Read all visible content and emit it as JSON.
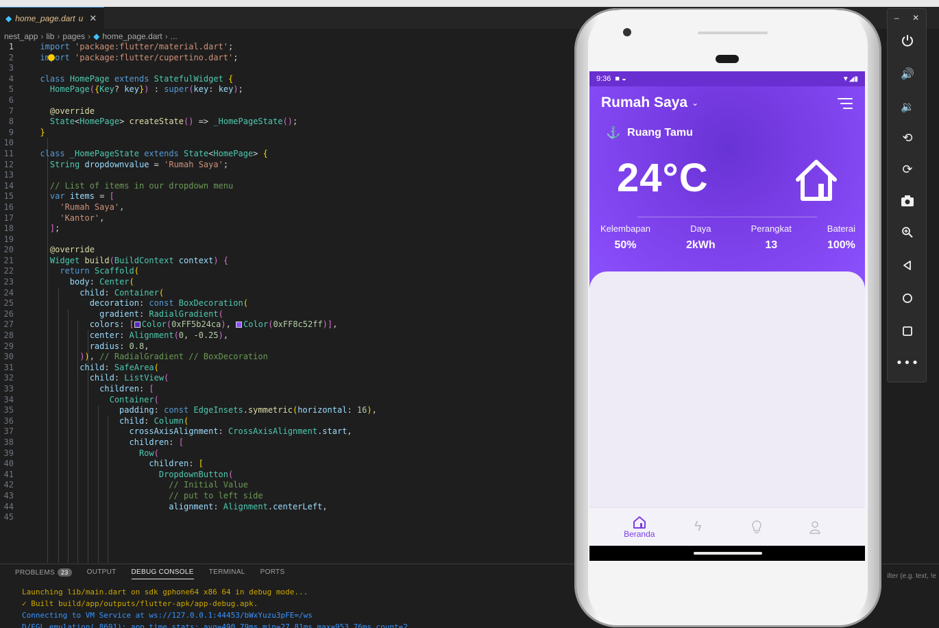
{
  "editor": {
    "tab": {
      "filename": "home_page.dart",
      "modified_flag": "U"
    },
    "breadcrumb": [
      "nest_app",
      "lib",
      "pages",
      "home_page.dart",
      "..."
    ],
    "lines": [
      "1",
      "2",
      "3",
      "4",
      "5",
      "6",
      "7",
      "8",
      "9",
      "10",
      "11",
      "12",
      "13",
      "14",
      "15",
      "16",
      "17",
      "18",
      "19",
      "20",
      "21",
      "22",
      "23",
      "24",
      "25",
      "26",
      "27",
      "28",
      "29",
      "30",
      "31",
      "32",
      "33",
      "34",
      "35",
      "36",
      "37",
      "38",
      "39",
      "40",
      "41",
      "42",
      "43",
      "44",
      "45"
    ]
  },
  "panel": {
    "tabs": {
      "problems": "PROBLEMS",
      "problems_count": "23",
      "output": "OUTPUT",
      "debug": "DEBUG CONSOLE",
      "terminal": "TERMINAL",
      "ports": "PORTS"
    },
    "console": [
      "Launching lib/main.dart on sdk gphone64 x86 64 in debug mode...",
      "✓  Built build/app/outputs/flutter-apk/app-debug.apk.",
      "Connecting to VM Service at ws://127.0.0.1:44453/bWxYuzu3pFE=/ws",
      "D/EGL_emulation( 8691): app_time_stats: avg=490.79ms min=27.81ms max=953.76ms count=2"
    ],
    "filter_placeholder": "ilter (e.g. text, !e"
  },
  "phone": {
    "status": {
      "time": "9:36"
    },
    "home_dropdown": "Rumah Saya",
    "room": "Ruang Tamu",
    "temperature": "24°C",
    "stats": [
      {
        "label": "Kelembapan",
        "value": "50%"
      },
      {
        "label": "Daya",
        "value": "2kWh"
      },
      {
        "label": "Perangkat",
        "value": "13"
      },
      {
        "label": "Baterai",
        "value": "100%"
      }
    ],
    "nav": {
      "home_label": "Beranda"
    }
  },
  "colors": {
    "accent": "#8c52ff",
    "accent_dark": "#5b24ca",
    "editor_bg": "#1e1e1e"
  }
}
